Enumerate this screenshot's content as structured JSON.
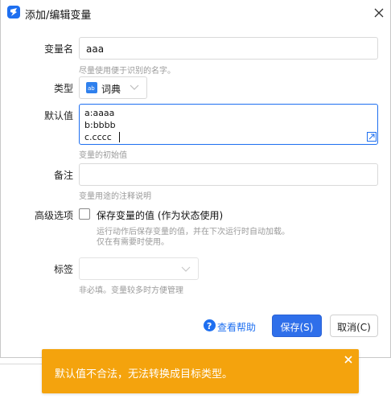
{
  "dialog": {
    "title": "添加/编辑变量"
  },
  "form": {
    "name": {
      "label": "变量名",
      "value": "aaa",
      "hint": "尽量使用便于识别的名字。"
    },
    "type": {
      "label": "类型",
      "value": "词典",
      "icon": "dictionary-icon"
    },
    "default_value": {
      "label": "默认值",
      "lines": [
        "a:aaaa",
        "b:bbbb",
        "c.cccc"
      ],
      "hint": "变量的初始值"
    },
    "remark": {
      "label": "备注",
      "value": "",
      "hint": "变量用途的注释说明"
    },
    "advanced": {
      "label": "高级选项",
      "checkbox_label": "保存变量的值 (作为状态使用)",
      "checked": false,
      "hint_lines": [
        "运行动作后保存变量的值，并在下次运行时自动加载。",
        "仅在有需要时使用。"
      ]
    },
    "tags": {
      "label": "标签",
      "value": "",
      "hint": "非必填。变量较多时方便管理"
    }
  },
  "footer": {
    "help_label": "查看帮助",
    "save_label": "保存(S)",
    "cancel_label": "取消(C)"
  },
  "toast": {
    "message": "默认值不合法，无法转换成目标类型。",
    "color": "#f4a30d"
  },
  "colors": {
    "accent": "#1e6ff0",
    "primary_button": "#2f6fea",
    "hint_text": "#9a9a9a"
  }
}
